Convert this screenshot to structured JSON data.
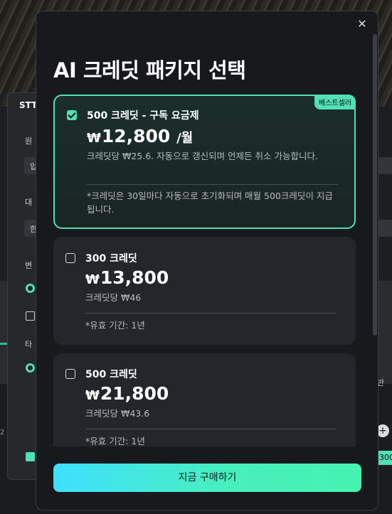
{
  "background": {
    "panel_title": "STT",
    "labels": [
      "원",
      "대",
      "변",
      "타"
    ],
    "fields": [
      "입",
      "한"
    ],
    "right_text": "반",
    "plus_label": "+",
    "badge_number": "300",
    "small_text": "2"
  },
  "modal": {
    "title": "AI 크레딧 패키지 선택",
    "close_label": "✕",
    "buy_button": "지금 구매하기"
  },
  "packages": [
    {
      "name": "500 크레딧 - 구독 요금제",
      "currency": "₩",
      "price": "12,800",
      "period": "/월",
      "sub": "크레딧당 ₩25.6. 자동으로 갱신되며 언제든 취소 가능합니다.",
      "note": "*크레딧은 30일마다 자동으로 초기화되며 매월 500크레딧이 지급됩니다.",
      "badge": "베스트셀러",
      "selected": true
    },
    {
      "name": "300 크레딧",
      "currency": "₩",
      "price": "13,800",
      "sub": "크레딧당 ₩46",
      "note": "*유효 기간: 1년",
      "selected": false
    },
    {
      "name": "500 크레딧",
      "currency": "₩",
      "price": "21,800",
      "sub": "크레딧당 ₩43.6",
      "note": "*유효 기간: 1년",
      "selected": false
    }
  ],
  "colors": {
    "accent": "#4fe0b6",
    "modal_bg": "#17191c",
    "card_bg": "#23262b",
    "button_gradient_start": "#3ee0ff",
    "button_gradient_end": "#45f3b0"
  }
}
